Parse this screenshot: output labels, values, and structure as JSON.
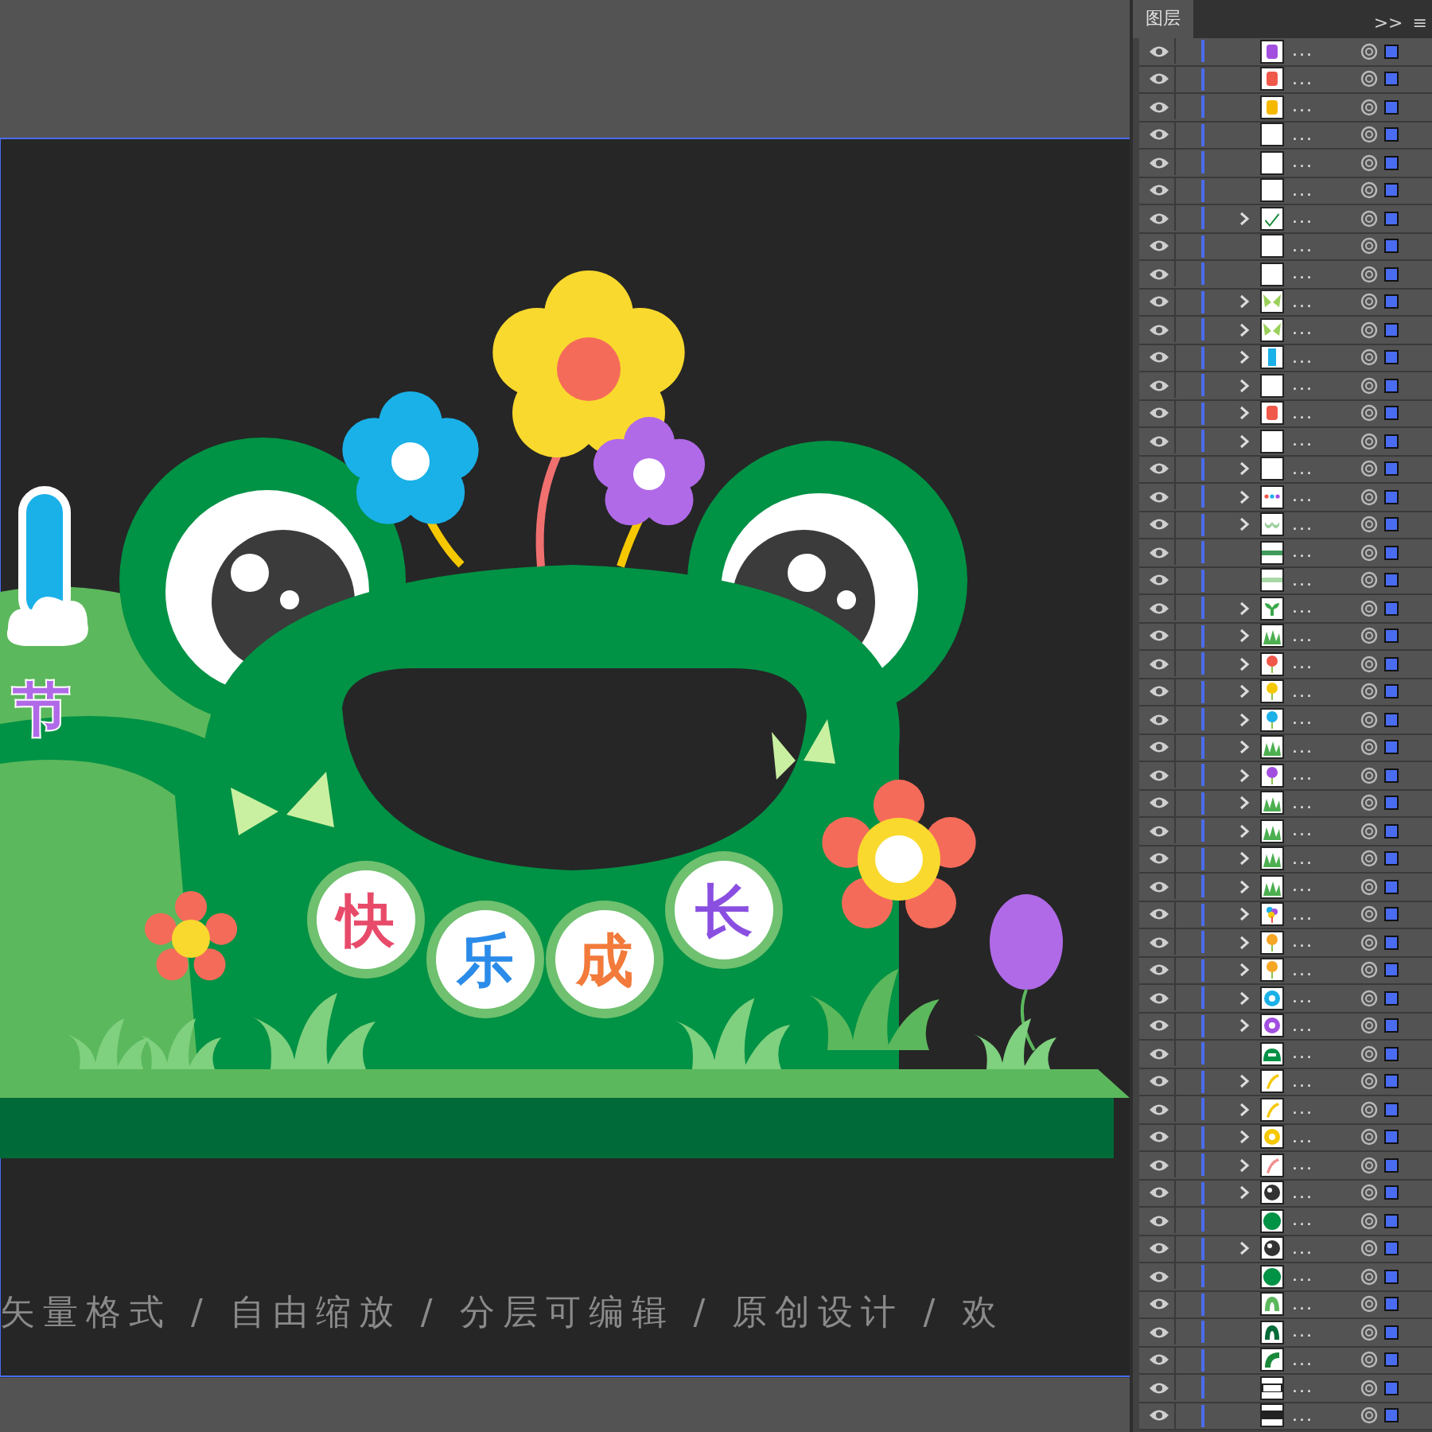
{
  "artwork": {
    "title_char": "节",
    "badges": [
      {
        "char": "快",
        "color": "#e84b6a"
      },
      {
        "char": "乐",
        "color": "#2a8be8"
      },
      {
        "char": "成",
        "color": "#f27a3a"
      },
      {
        "char": "长",
        "color": "#8a4fe0"
      }
    ],
    "footer_text": "矢量格式 / 自由缩放 / 分层可编辑 / 原创设计 / 欢"
  },
  "layers_panel": {
    "tab": "图层",
    "overflow": ">>",
    "menu": "≡",
    "layers": [
      {
        "name": "...",
        "expandable": false,
        "kind": "glyph",
        "color": "#a24fe0"
      },
      {
        "name": "...",
        "expandable": false,
        "kind": "glyph",
        "color": "#f0584a"
      },
      {
        "name": "...",
        "expandable": false,
        "kind": "glyph",
        "color": "#f5b800"
      },
      {
        "name": "...",
        "expandable": false,
        "kind": "blank"
      },
      {
        "name": "...",
        "expandable": false,
        "kind": "blank"
      },
      {
        "name": "...",
        "expandable": false,
        "kind": "blank"
      },
      {
        "name": "...",
        "expandable": true,
        "kind": "check"
      },
      {
        "name": "...",
        "expandable": false,
        "kind": "blank"
      },
      {
        "name": "...",
        "expandable": false,
        "kind": "blank"
      },
      {
        "name": "...",
        "expandable": true,
        "kind": "butterfly"
      },
      {
        "name": "...",
        "expandable": true,
        "kind": "butterfly"
      },
      {
        "name": "...",
        "expandable": true,
        "kind": "bar",
        "color": "#1ab0e8"
      },
      {
        "name": "...",
        "expandable": true,
        "kind": "blank"
      },
      {
        "name": "...",
        "expandable": true,
        "kind": "glyph",
        "color": "#f0584a"
      },
      {
        "name": "...",
        "expandable": true,
        "kind": "blank"
      },
      {
        "name": "...",
        "expandable": true,
        "kind": "blank"
      },
      {
        "name": "...",
        "expandable": true,
        "kind": "dots"
      },
      {
        "name": "...",
        "expandable": true,
        "kind": "garland"
      },
      {
        "name": "...",
        "expandable": false,
        "kind": "line",
        "color": "#3f9a5a"
      },
      {
        "name": "...",
        "expandable": false,
        "kind": "line",
        "color": "#a8d8a8"
      },
      {
        "name": "...",
        "expandable": true,
        "kind": "sprout"
      },
      {
        "name": "...",
        "expandable": true,
        "kind": "grass"
      },
      {
        "name": "...",
        "expandable": true,
        "kind": "flower",
        "color": "#f0584a"
      },
      {
        "name": "...",
        "expandable": true,
        "kind": "flower",
        "color": "#f5c800"
      },
      {
        "name": "...",
        "expandable": true,
        "kind": "flower",
        "color": "#1ab0e8"
      },
      {
        "name": "...",
        "expandable": true,
        "kind": "grass"
      },
      {
        "name": "...",
        "expandable": true,
        "kind": "flower",
        "color": "#a24fe0"
      },
      {
        "name": "...",
        "expandable": true,
        "kind": "grass"
      },
      {
        "name": "...",
        "expandable": true,
        "kind": "grass"
      },
      {
        "name": "...",
        "expandable": true,
        "kind": "grass"
      },
      {
        "name": "...",
        "expandable": true,
        "kind": "grass"
      },
      {
        "name": "...",
        "expandable": true,
        "kind": "pinwheel"
      },
      {
        "name": "...",
        "expandable": true,
        "kind": "flower",
        "color": "#f5a623"
      },
      {
        "name": "...",
        "expandable": true,
        "kind": "flower",
        "color": "#f5a623"
      },
      {
        "name": "...",
        "expandable": true,
        "kind": "blossom",
        "color": "#1ab0e8"
      },
      {
        "name": "...",
        "expandable": true,
        "kind": "blossom",
        "color": "#a24fe0"
      },
      {
        "name": "...",
        "expandable": false,
        "kind": "dome"
      },
      {
        "name": "...",
        "expandable": true,
        "kind": "stroke",
        "color": "#f5c800"
      },
      {
        "name": "...",
        "expandable": true,
        "kind": "stroke",
        "color": "#f5c800"
      },
      {
        "name": "...",
        "expandable": true,
        "kind": "blossom",
        "color": "#f5c800"
      },
      {
        "name": "...",
        "expandable": true,
        "kind": "stroke",
        "color": "#f09090"
      },
      {
        "name": "...",
        "expandable": true,
        "kind": "eye"
      },
      {
        "name": "...",
        "expandable": false,
        "kind": "disc"
      },
      {
        "name": "...",
        "expandable": true,
        "kind": "eye"
      },
      {
        "name": "...",
        "expandable": false,
        "kind": "disc"
      },
      {
        "name": "...",
        "expandable": false,
        "kind": "arch",
        "color": "#5cb85c"
      },
      {
        "name": "...",
        "expandable": false,
        "kind": "arch",
        "color": "#006a38"
      },
      {
        "name": "...",
        "expandable": false,
        "kind": "hook"
      },
      {
        "name": "...",
        "expandable": false,
        "kind": "stripe",
        "color": "#ffffff"
      },
      {
        "name": "...",
        "expandable": false,
        "kind": "stripe",
        "color": "#222222"
      }
    ]
  }
}
